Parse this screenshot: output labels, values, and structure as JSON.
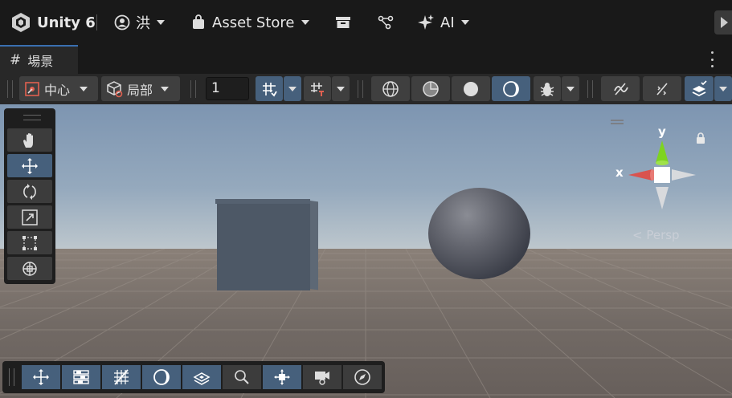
{
  "topbar": {
    "app_name": "Unity 6",
    "account_name": "洪",
    "asset_store_label": "Asset Store",
    "ai_label": "AI",
    "icons": [
      "unity-logo-icon",
      "account-icon",
      "asset-store-bag-icon",
      "package-manager-icon",
      "version-control-icon",
      "ai-sparkle-icon",
      "play-icon"
    ]
  },
  "tabs": [
    {
      "label": "場景",
      "icon": "scene-grid-icon",
      "active": true
    }
  ],
  "scene_toolbar": {
    "pivot_mode": "中心",
    "pivot_rotation": "局部",
    "grid_snap_value": "1",
    "icons": [
      "pivot-icon",
      "cube-icon",
      "grid-snap-icon",
      "increment-snap-icon",
      "wireframe-icon",
      "shaded-wireframe-icon",
      "shaded-icon",
      "lighting-icon",
      "debug-icon",
      "audio-mute-icon",
      "fx-icon",
      "layers-icon"
    ]
  },
  "tools": [
    {
      "name": "hand",
      "icon": "hand-icon",
      "active": false
    },
    {
      "name": "move",
      "icon": "move-icon",
      "active": true
    },
    {
      "name": "rotate",
      "icon": "rotate-icon",
      "active": false
    },
    {
      "name": "scale",
      "icon": "scale-icon",
      "active": false
    },
    {
      "name": "rect",
      "icon": "rect-tool-icon",
      "active": false
    },
    {
      "name": "transform",
      "icon": "transform-icon",
      "active": false
    }
  ],
  "gizmo": {
    "y_label": "y",
    "x_label": "x",
    "projection_label": "< Persp",
    "colors": {
      "y_axis": "#7ed321",
      "x_axis": "#d9534f",
      "center": "#ffffff"
    }
  },
  "bottom_overlay": {
    "icons": [
      "move-overlay-icon",
      "settings-overlay-icon",
      "grid-overlay-icon",
      "lighting-overlay-icon",
      "layers-overlay-icon",
      "search-overlay-icon",
      "snap-overlay-icon",
      "camera-overlay-icon",
      "compass-overlay-icon"
    ],
    "active": [
      true,
      true,
      true,
      true,
      true,
      false,
      true,
      false,
      false
    ]
  },
  "colors": {
    "accent": "#46607c",
    "background": "#191919",
    "toolbar": "#282828"
  }
}
